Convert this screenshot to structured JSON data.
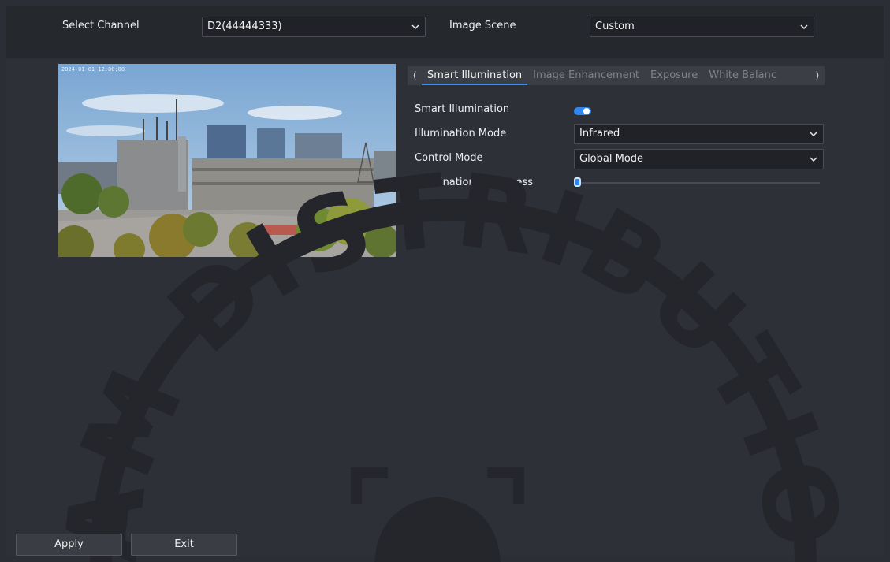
{
  "header": {
    "select_channel_label": "Select Channel",
    "channel_value": "D2(44444333)",
    "image_scene_label": "Image Scene",
    "image_scene_value": "Custom"
  },
  "preview": {
    "osd_text": "2024-01-01 12:00:00"
  },
  "tabs": {
    "prev_arrow": "⟨",
    "next_arrow": "⟩",
    "items": [
      {
        "label": "Smart Illumination",
        "active": true
      },
      {
        "label": "Image Enhancement",
        "active": false
      },
      {
        "label": "Exposure",
        "active": false
      },
      {
        "label": "White Balanc",
        "active": false
      }
    ]
  },
  "settings": {
    "smart_illumination_label": "Smart Illumination",
    "smart_illumination_on": true,
    "illumination_mode_label": "Illumination Mode",
    "illumination_mode_value": "Infrared",
    "control_mode_label": "Control Mode",
    "control_mode_value": "Global Mode",
    "brightness_label": "Illumination Brightness",
    "brightness_value": 0
  },
  "watermark": {
    "text": "CAM DISTRIBUTION"
  },
  "footer": {
    "apply_label": "Apply",
    "exit_label": "Exit"
  },
  "colors": {
    "accent": "#2f86f0",
    "background": "#2d3037",
    "header": "#25282d"
  }
}
